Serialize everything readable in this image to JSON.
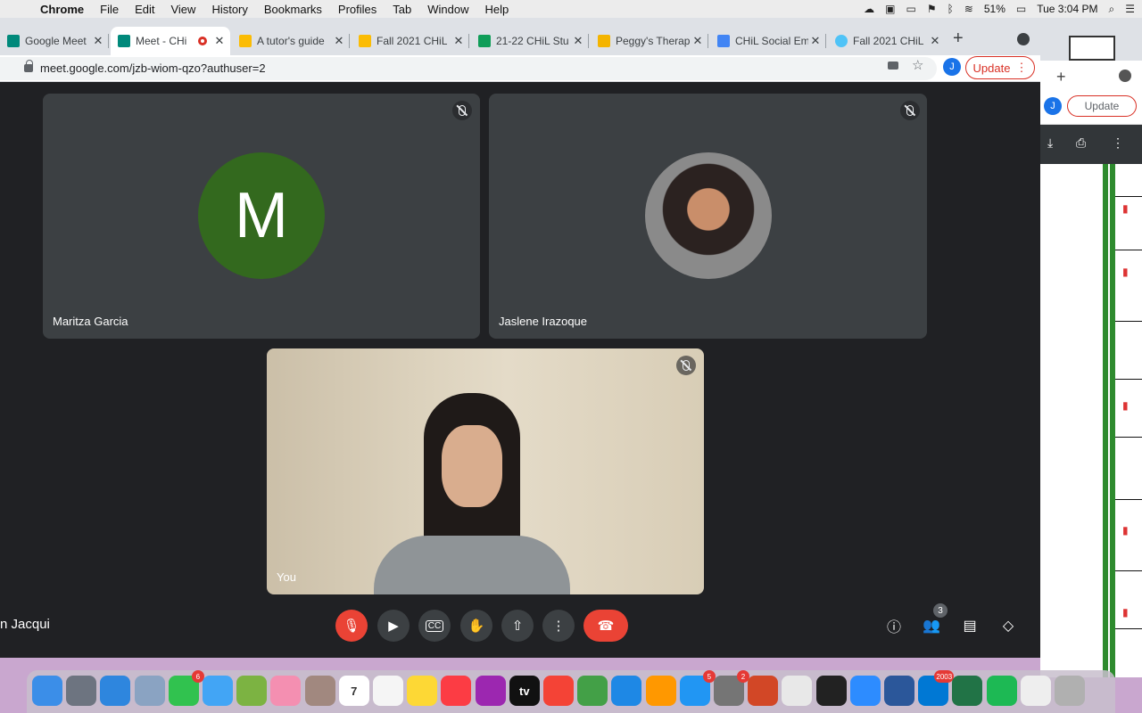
{
  "menubar": {
    "apple_icon": "apple-icon",
    "app_name": "Chrome",
    "menus": [
      "File",
      "Edit",
      "View",
      "History",
      "Bookmarks",
      "Profiles",
      "Tab",
      "Window",
      "Help"
    ],
    "battery": "51%",
    "clock": "Tue 3:04 PM"
  },
  "browser": {
    "tabs": [
      {
        "title": "Google Meet",
        "favicon": "meet-icon",
        "color": "#00897b"
      },
      {
        "title": "Meet - CHi",
        "favicon": "meet-icon",
        "color": "#00897b",
        "active": true,
        "recording": true
      },
      {
        "title": "A tutor's guide",
        "favicon": "drive-icon",
        "color": "#fbbc04"
      },
      {
        "title": "Fall 2021 CHiL",
        "favicon": "drive-icon",
        "color": "#fbbc04"
      },
      {
        "title": "21-22 CHiL Stu",
        "favicon": "sheets-icon",
        "color": "#0f9d58"
      },
      {
        "title": "Peggy's Therap",
        "favicon": "slides-icon",
        "color": "#f4b400"
      },
      {
        "title": "CHiL Social Em",
        "favicon": "docs-icon",
        "color": "#4285f4"
      },
      {
        "title": "Fall 2021 CHiL",
        "favicon": "loading-icon",
        "color": "#4fc3f7"
      }
    ],
    "url": "meet.google.com/jzb-wiom-qzo?authuser=2",
    "avatar_letter": "J",
    "update_label": "Update"
  },
  "meet": {
    "participants": [
      {
        "name": "Maritza Garcia",
        "initial": "M",
        "avatar_color": "#33691e"
      },
      {
        "name": "Jaslene Irazoque"
      },
      {
        "name": "You"
      }
    ],
    "meeting_name": "n Jacqui",
    "people_count": "3",
    "leave_color": "#ea4335"
  },
  "background_window": {
    "avatar_letter": "J",
    "update_label": "Update"
  },
  "dock": {
    "apps": [
      {
        "name": "finder-icon",
        "color": "#3b8ee8"
      },
      {
        "name": "launchpad-icon",
        "color": "#6d7480"
      },
      {
        "name": "safari-icon",
        "color": "#2e86de"
      },
      {
        "name": "preview-icon",
        "color": "#8aa3c2"
      },
      {
        "name": "facetime-icon",
        "color": "#31c24f",
        "badge": "6"
      },
      {
        "name": "messages-icon",
        "color": "#42a5f5"
      },
      {
        "name": "maps-icon",
        "color": "#7cb342"
      },
      {
        "name": "photos-icon",
        "color": "#f48fb1"
      },
      {
        "name": "contacts-icon",
        "color": "#a1887f"
      },
      {
        "name": "calendar-icon",
        "color": "#ffffff",
        "label": "7"
      },
      {
        "name": "reminders-icon",
        "color": "#f5f5f5"
      },
      {
        "name": "notes-icon",
        "color": "#fdd835"
      },
      {
        "name": "music-icon",
        "color": "#fc3c44"
      },
      {
        "name": "podcasts-icon",
        "color": "#9c27b0"
      },
      {
        "name": "apple-tv-icon",
        "color": "#111111",
        "label": "tv"
      },
      {
        "name": "news-icon",
        "color": "#f44336"
      },
      {
        "name": "numbers-icon",
        "color": "#43a047"
      },
      {
        "name": "keynote-icon",
        "color": "#1e88e5"
      },
      {
        "name": "pages-icon",
        "color": "#ff9800"
      },
      {
        "name": "app-store-icon",
        "color": "#2196f3",
        "badge": "5"
      },
      {
        "name": "system-preferences-icon",
        "color": "#757575",
        "badge": "2"
      },
      {
        "name": "powerpoint-icon",
        "color": "#d24726"
      },
      {
        "name": "chrome-icon",
        "color": "#e8e8e8"
      },
      {
        "name": "terminal-icon",
        "color": "#222222"
      },
      {
        "name": "zoom-icon",
        "color": "#2d8cff"
      },
      {
        "name": "word-icon",
        "color": "#2b579a"
      },
      {
        "name": "outlook-icon",
        "color": "#0078d4",
        "badge": "2003"
      },
      {
        "name": "excel-icon",
        "color": "#217346"
      },
      {
        "name": "spotify-icon",
        "color": "#1db954"
      },
      {
        "name": "document-icon",
        "color": "#eeeeee"
      },
      {
        "name": "trash-icon",
        "color": "#b0b0b0"
      }
    ]
  }
}
